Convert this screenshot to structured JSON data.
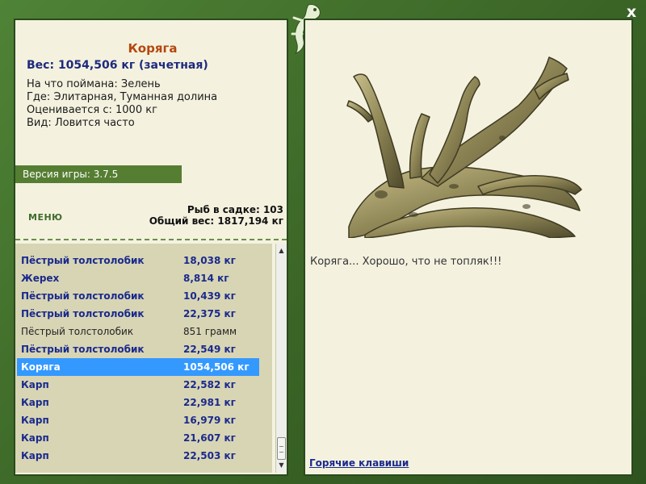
{
  "header": {
    "close_label": "x"
  },
  "catch": {
    "name": "Коряга",
    "weight": "Вес: 1054,506 кг (зачетная)",
    "caught_on_label": "На что поймана:",
    "caught_on_value": "Зелень",
    "where_label": "Где:",
    "where_value": "Элитарная, Туманная долина",
    "value_label": "Оценивается с:",
    "value_value": "1000 кг",
    "kind_label": "Вид:",
    "kind_value": "Ловится часто"
  },
  "version": "Версия игры: 3.7.5",
  "menu_label": "МЕНЮ",
  "stats": {
    "fish_in_keepnet": "Рыб в садке: 103",
    "total_weight": "Общий вес: 1817,194 кг"
  },
  "fish_list": [
    {
      "name": "Пёстрый толстолобик",
      "weight": "18,038 кг",
      "style": "bold"
    },
    {
      "name": "Жерех",
      "weight": "8,814 кг",
      "style": "bold"
    },
    {
      "name": "Пёстрый толстолобик",
      "weight": "10,439 кг",
      "style": "bold"
    },
    {
      "name": "Пёстрый толстолобик",
      "weight": "22,375 кг",
      "style": "bold"
    },
    {
      "name": "Пёстрый толстолобик",
      "weight": "851 грамм",
      "style": "plain"
    },
    {
      "name": "Пёстрый толстолобик",
      "weight": "22,549 кг",
      "style": "bold"
    },
    {
      "name": "Коряга",
      "weight": "1054,506 кг",
      "style": "sel"
    },
    {
      "name": "Карп",
      "weight": "22,582 кг",
      "style": "bold"
    },
    {
      "name": "Карп",
      "weight": "22,981 кг",
      "style": "bold"
    },
    {
      "name": "Карп",
      "weight": "16,979 кг",
      "style": "bold"
    },
    {
      "name": "Карп",
      "weight": "21,607 кг",
      "style": "bold"
    },
    {
      "name": "Карп",
      "weight": "22,503 кг",
      "style": "bold"
    }
  ],
  "message": "Коряга... Хорошо, что не топляк!!!",
  "hotkeys_label": "Горячие клавиши",
  "colors": {
    "frame": "#3e6b2a",
    "panel": "#f4f2df",
    "list_bg": "#d8d5b5",
    "selected": "#3399ff",
    "name_title": "#b5470f",
    "bold_text": "#1a2a8c"
  },
  "icons": {
    "close": "close-icon",
    "logo": "lizard-icon",
    "scroll_up": "arrow-up-icon",
    "scroll_down": "arrow-down-icon"
  }
}
